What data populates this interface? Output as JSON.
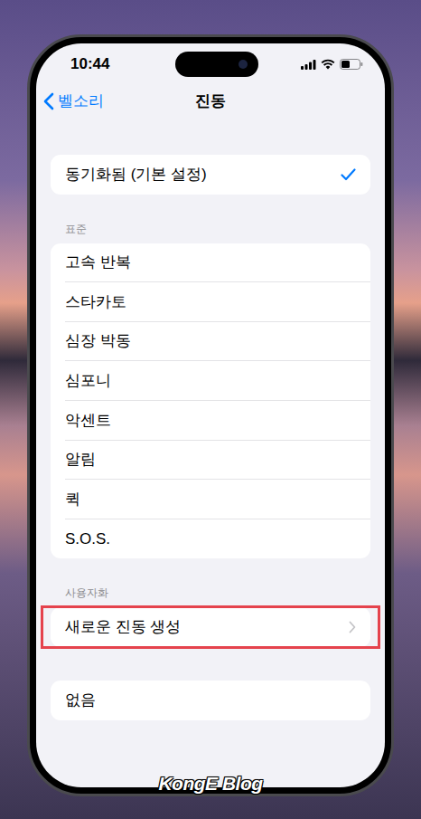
{
  "status_bar": {
    "time": "10:44"
  },
  "nav": {
    "back": "벨소리",
    "title": "진동"
  },
  "sections": [
    {
      "header": "",
      "items": [
        {
          "label": "동기화됨 (기본 설정)",
          "kind": "option",
          "selected": true
        }
      ]
    },
    {
      "header": "표준",
      "items": [
        {
          "label": "고속 반복",
          "kind": "option",
          "selected": false
        },
        {
          "label": "스타카토",
          "kind": "option",
          "selected": false
        },
        {
          "label": "심장 박동",
          "kind": "option",
          "selected": false
        },
        {
          "label": "심포니",
          "kind": "option",
          "selected": false
        },
        {
          "label": "악센트",
          "kind": "option",
          "selected": false
        },
        {
          "label": "알림",
          "kind": "option",
          "selected": false
        },
        {
          "label": "퀵",
          "kind": "option",
          "selected": false
        },
        {
          "label": "S.O.S.",
          "kind": "option",
          "selected": false
        }
      ]
    },
    {
      "header": "사용자화",
      "items": [
        {
          "label": "새로운 진동 생성",
          "kind": "link",
          "highlighted": true
        }
      ]
    },
    {
      "header": "",
      "items": [
        {
          "label": "없음",
          "kind": "option",
          "selected": false
        }
      ]
    }
  ],
  "watermark": "KongE Blog"
}
